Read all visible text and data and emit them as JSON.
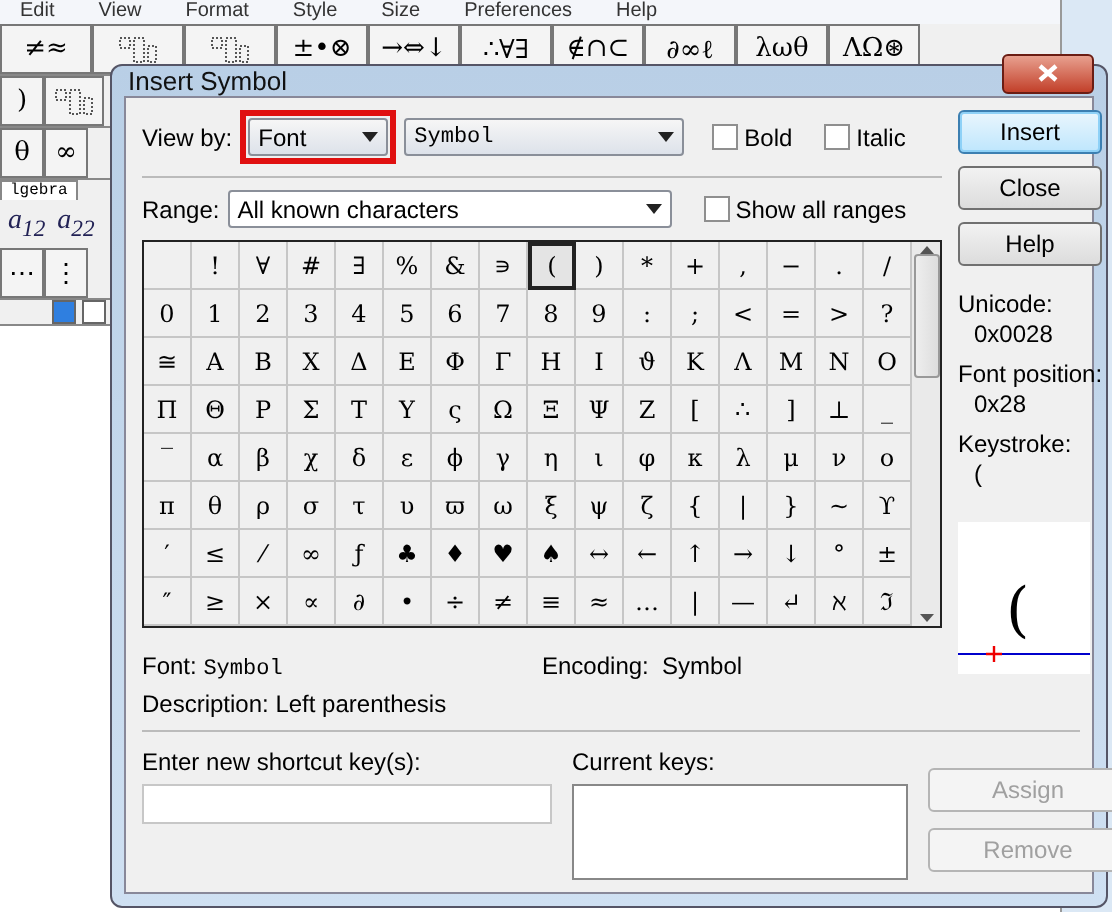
{
  "app": {
    "menu": [
      "Edit",
      "View",
      "Format",
      "Style",
      "Size",
      "Preferences",
      "Help"
    ],
    "palette": [
      {
        "kind": "text",
        "label": "≠≈"
      },
      {
        "kind": "template"
      },
      {
        "kind": "template"
      },
      {
        "kind": "text",
        "label": "±•⊗"
      },
      {
        "kind": "text",
        "label": "→⇔↓"
      },
      {
        "kind": "text",
        "label": "∴∀∃"
      },
      {
        "kind": "text",
        "label": "∉∩⊂"
      },
      {
        "kind": "text",
        "label": "∂∞ℓ"
      },
      {
        "kind": "text",
        "label": "λωθ"
      },
      {
        "kind": "text",
        "label": "ΛΩ⊛"
      }
    ],
    "row2": [
      {
        "kind": "text",
        "label": ")"
      },
      {
        "kind": "template"
      }
    ],
    "row3": [
      {
        "kind": "text",
        "label": "θ"
      },
      {
        "kind": "text",
        "label": "∞"
      }
    ],
    "tab": "lgebra",
    "matrix": [
      "a$_{12}$",
      "a$_{22}$"
    ],
    "row5": [
      {
        "kind": "text",
        "label": "⋯"
      },
      {
        "kind": "text",
        "label": "⋮"
      }
    ]
  },
  "dialog": {
    "title": "Insert Symbol",
    "view_by": {
      "label": "View by:",
      "value": "Font",
      "highlighted": true
    },
    "font_select": "Symbol",
    "bold": {
      "label": "Bold",
      "checked": false
    },
    "italic": {
      "label": "Italic",
      "checked": false
    },
    "range": {
      "label": "Range:",
      "value": "All known characters"
    },
    "show_all_ranges": {
      "label": "Show all ranges",
      "checked": false
    },
    "grid": [
      [
        {
          "selected": false
        },
        {
          "char": "!",
          "selected": false
        },
        {
          "char": "∀",
          "selected": false
        },
        {
          "char": "#",
          "selected": false
        },
        {
          "char": "∃",
          "selected": false
        },
        {
          "char": "%",
          "selected": false
        },
        {
          "char": "&",
          "selected": false
        },
        {
          "char": "∍",
          "selected": false
        },
        {
          "char": "(",
          "selected": true
        },
        {
          "char": ")",
          "selected": false
        },
        {
          "char": "*",
          "selected": false
        },
        {
          "char": "+",
          "selected": false
        },
        {
          "char": ",",
          "selected": false
        },
        {
          "char": "−",
          "selected": false
        },
        {
          "char": ".",
          "selected": false
        },
        {
          "char": "/",
          "selected": false
        }
      ],
      [
        {
          "char": "0",
          "selected": false
        },
        {
          "char": "1",
          "selected": false
        },
        {
          "char": "2",
          "selected": false
        },
        {
          "char": "3",
          "selected": false
        },
        {
          "char": "4",
          "selected": false
        },
        {
          "char": "5",
          "selected": false
        },
        {
          "char": "6",
          "selected": false
        },
        {
          "char": "7",
          "selected": false
        },
        {
          "char": "8",
          "selected": false
        },
        {
          "char": "9",
          "selected": false
        },
        {
          "char": ":",
          "selected": false
        },
        {
          "char": ";",
          "selected": false
        },
        {
          "char": "<",
          "selected": false
        },
        {
          "char": "=",
          "selected": false
        },
        {
          "char": ">",
          "selected": false
        },
        {
          "char": "?",
          "selected": false
        }
      ],
      [
        {
          "char": "≅",
          "selected": false
        },
        {
          "char": "Α",
          "selected": false
        },
        {
          "char": "Β",
          "selected": false
        },
        {
          "char": "Χ",
          "selected": false
        },
        {
          "char": "Δ",
          "selected": false
        },
        {
          "char": "Ε",
          "selected": false
        },
        {
          "char": "Φ",
          "selected": false
        },
        {
          "char": "Γ",
          "selected": false
        },
        {
          "char": "Η",
          "selected": false
        },
        {
          "char": "Ι",
          "selected": false
        },
        {
          "char": "ϑ",
          "selected": false
        },
        {
          "char": "Κ",
          "selected": false
        },
        {
          "char": "Λ",
          "selected": false
        },
        {
          "char": "Μ",
          "selected": false
        },
        {
          "char": "Ν",
          "selected": false
        },
        {
          "char": "Ο",
          "selected": false
        }
      ],
      [
        {
          "char": "Π",
          "selected": false
        },
        {
          "char": "Θ",
          "selected": false
        },
        {
          "char": "Ρ",
          "selected": false
        },
        {
          "char": "Σ",
          "selected": false
        },
        {
          "char": "Τ",
          "selected": false
        },
        {
          "char": "Υ",
          "selected": false
        },
        {
          "char": "ς",
          "selected": false
        },
        {
          "char": "Ω",
          "selected": false
        },
        {
          "char": "Ξ",
          "selected": false
        },
        {
          "char": "Ψ",
          "selected": false
        },
        {
          "char": "Ζ",
          "selected": false
        },
        {
          "char": "[",
          "selected": false
        },
        {
          "char": "∴",
          "selected": false
        },
        {
          "char": "]",
          "selected": false
        },
        {
          "char": "⊥",
          "selected": false
        },
        {
          "char": "_",
          "selected": false
        }
      ],
      [
        {
          "char": "‾",
          "selected": false
        },
        {
          "char": "α",
          "selected": false
        },
        {
          "char": "β",
          "selected": false
        },
        {
          "char": "χ",
          "selected": false
        },
        {
          "char": "δ",
          "selected": false
        },
        {
          "char": "ε",
          "selected": false
        },
        {
          "char": "ϕ",
          "selected": false
        },
        {
          "char": "γ",
          "selected": false
        },
        {
          "char": "η",
          "selected": false
        },
        {
          "char": "ι",
          "selected": false
        },
        {
          "char": "φ",
          "selected": false
        },
        {
          "char": "κ",
          "selected": false
        },
        {
          "char": "λ",
          "selected": false
        },
        {
          "char": "μ",
          "selected": false
        },
        {
          "char": "ν",
          "selected": false
        },
        {
          "char": "ο",
          "selected": false
        }
      ],
      [
        {
          "char": "π",
          "selected": false
        },
        {
          "char": "θ",
          "selected": false
        },
        {
          "char": "ρ",
          "selected": false
        },
        {
          "char": "σ",
          "selected": false
        },
        {
          "char": "τ",
          "selected": false
        },
        {
          "char": "υ",
          "selected": false
        },
        {
          "char": "ϖ",
          "selected": false
        },
        {
          "char": "ω",
          "selected": false
        },
        {
          "char": "ξ",
          "selected": false
        },
        {
          "char": "ψ",
          "selected": false
        },
        {
          "char": "ζ",
          "selected": false
        },
        {
          "char": "{",
          "selected": false
        },
        {
          "char": "|",
          "selected": false
        },
        {
          "char": "}",
          "selected": false
        },
        {
          "char": "~",
          "selected": false
        },
        {
          "char": "ϒ",
          "selected": false
        }
      ],
      [
        {
          "char": "′",
          "selected": false
        },
        {
          "char": "≤",
          "selected": false
        },
        {
          "char": "⁄",
          "selected": false
        },
        {
          "char": "∞",
          "selected": false
        },
        {
          "char": "ƒ",
          "selected": false
        },
        {
          "char": "♣",
          "selected": false
        },
        {
          "char": "♦",
          "selected": false
        },
        {
          "char": "♥",
          "selected": false
        },
        {
          "char": "♠",
          "selected": false
        },
        {
          "char": "↔",
          "selected": false
        },
        {
          "char": "←",
          "selected": false
        },
        {
          "char": "↑",
          "selected": false
        },
        {
          "char": "→",
          "selected": false
        },
        {
          "char": "↓",
          "selected": false
        },
        {
          "char": "°",
          "selected": false
        },
        {
          "char": "±",
          "selected": false
        }
      ],
      [
        {
          "char": "″",
          "selected": false
        },
        {
          "char": "≥",
          "selected": false
        },
        {
          "char": "×",
          "selected": false
        },
        {
          "char": "∝",
          "selected": false
        },
        {
          "char": "∂",
          "selected": false
        },
        {
          "char": "•",
          "selected": false
        },
        {
          "char": "÷",
          "selected": false
        },
        {
          "char": "≠",
          "selected": false
        },
        {
          "char": "≡",
          "selected": false
        },
        {
          "char": "≈",
          "selected": false
        },
        {
          "char": "…",
          "selected": false
        },
        {
          "char": "|",
          "selected": false
        },
        {
          "char": "—",
          "selected": false
        },
        {
          "char": "↵",
          "selected": false
        },
        {
          "char": "ℵ",
          "selected": false
        },
        {
          "char": "ℑ",
          "selected": false
        }
      ]
    ],
    "buttons": [
      {
        "label": "Insert",
        "default": true
      },
      {
        "label": "Close",
        "default": false
      },
      {
        "label": "Help",
        "default": false
      }
    ],
    "info": [
      {
        "label": "Unicode:",
        "value": "0x0028"
      },
      {
        "label": "Font position:",
        "value": "0x28"
      },
      {
        "label": "Keystroke:",
        "value": "("
      }
    ],
    "preview": "(",
    "font": {
      "label": "Font:",
      "value": "Symbol"
    },
    "encoding": {
      "label": "Encoding:",
      "value": "Symbol"
    },
    "description": {
      "label": "Description:",
      "value": "Left parenthesis"
    },
    "shortcut": {
      "label": "Enter new shortcut key(s):"
    },
    "current_keys": {
      "label": "Current keys:"
    },
    "actions": [
      {
        "label": "Assign",
        "disabled": true
      },
      {
        "label": "Remove",
        "disabled": true
      }
    ]
  }
}
